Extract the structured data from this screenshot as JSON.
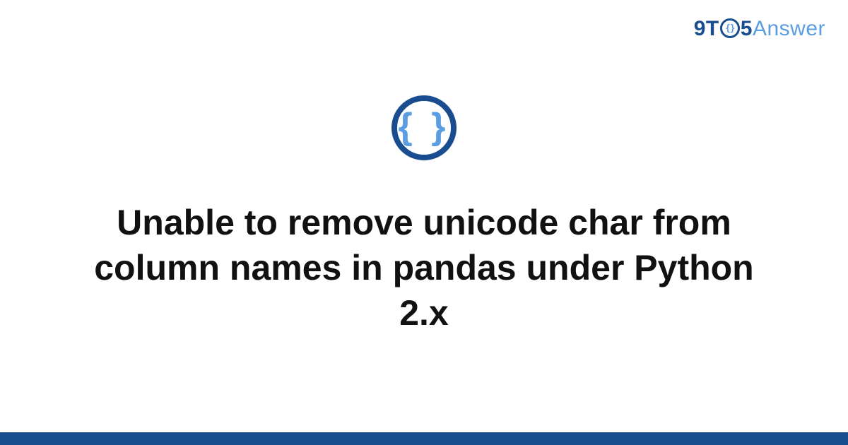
{
  "logo": {
    "part1": "9T",
    "circle_inner": "{}",
    "part2": "5",
    "part3": "Answer"
  },
  "icon": {
    "braces": "{ }"
  },
  "title": "Unable to remove unicode char from column names in pandas under Python 2.x"
}
